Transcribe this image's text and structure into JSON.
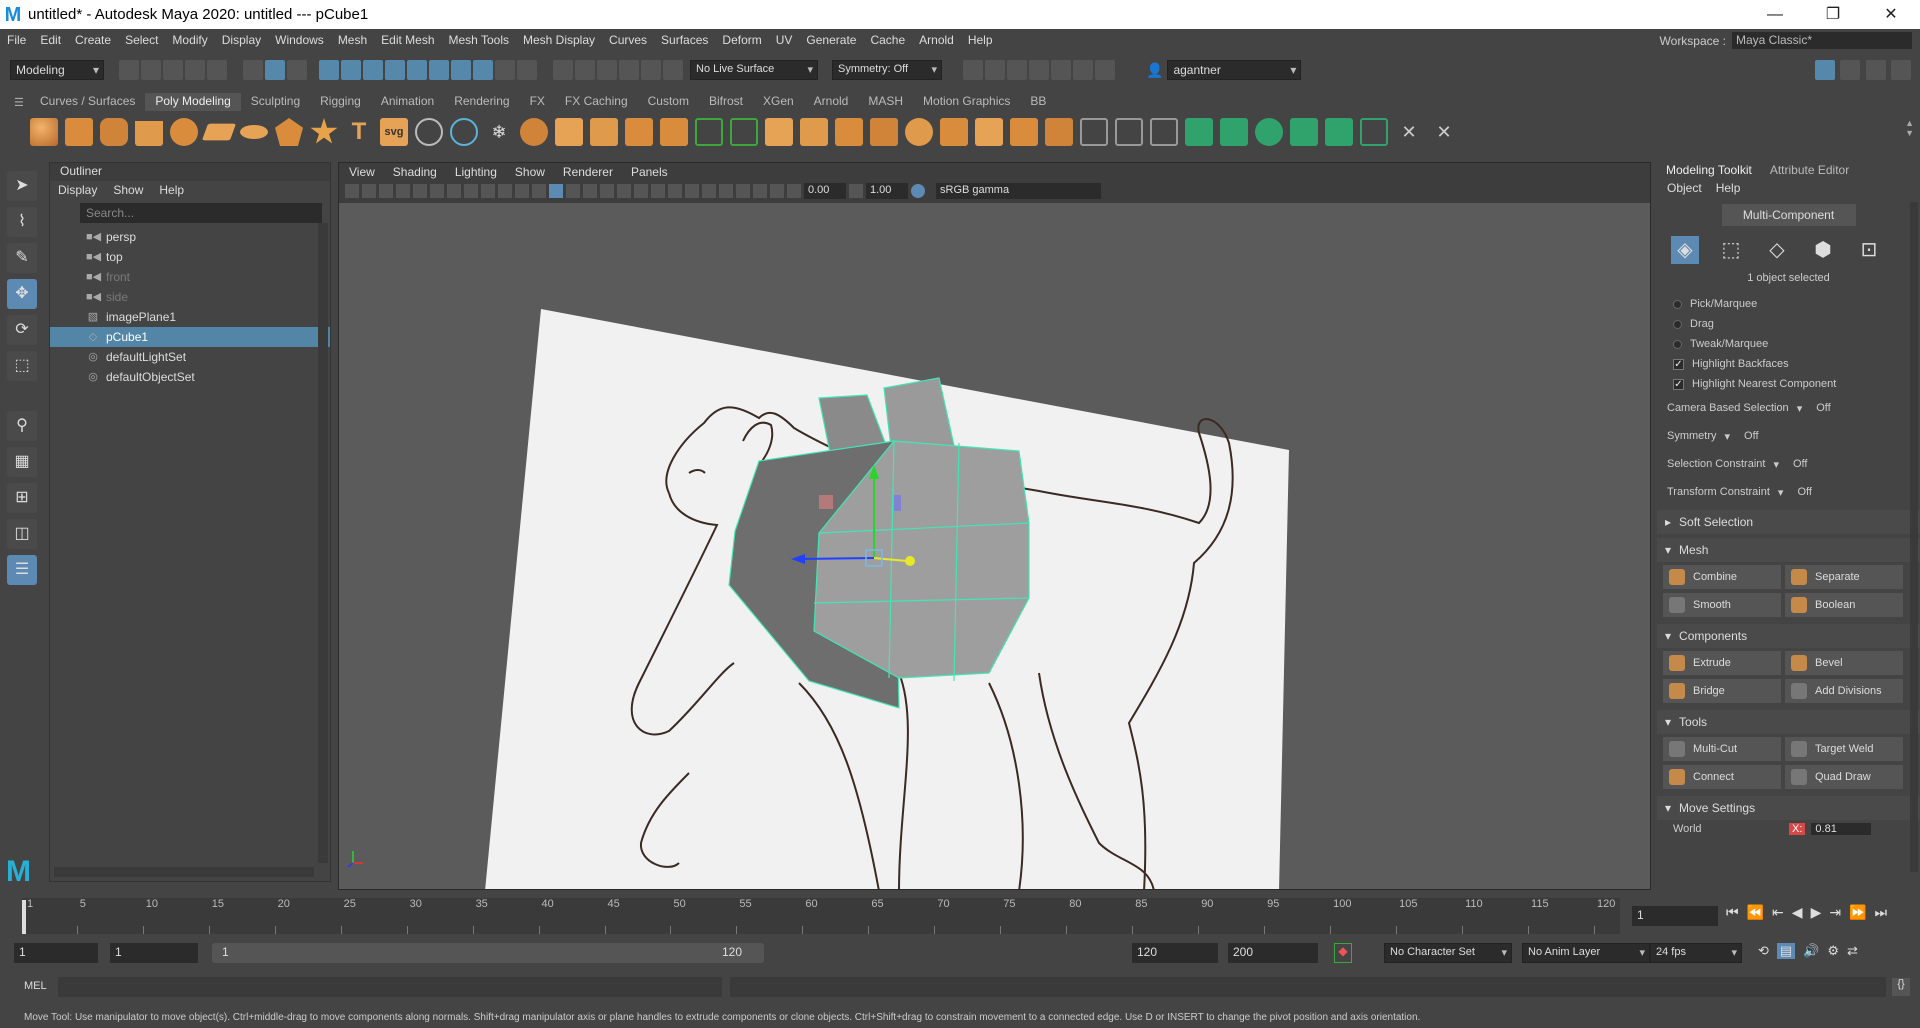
{
  "window": {
    "title": "untitled* - Autodesk Maya 2020: untitled   ---   pCube1",
    "app_icon_letter": "M",
    "controls": [
      "—",
      "❐",
      "✕"
    ]
  },
  "menubar": [
    "File",
    "Edit",
    "Create",
    "Select",
    "Modify",
    "Display",
    "Windows",
    "Mesh",
    "Edit Mesh",
    "Mesh Tools",
    "Mesh Display",
    "Curves",
    "Surfaces",
    "Deform",
    "UV",
    "Generate",
    "Cache",
    "Arnold",
    "Help"
  ],
  "workspace": {
    "label": "Workspace :",
    "value": "Maya Classic*"
  },
  "statusline": {
    "mode": "Modeling",
    "live_surface": "No Live Surface",
    "symmetry": "Symmetry: Off",
    "user": "agantner"
  },
  "shelf_tabs": [
    "Curves / Surfaces",
    "Poly Modeling",
    "Sculpting",
    "Rigging",
    "Animation",
    "Rendering",
    "FX",
    "FX Caching",
    "Custom",
    "Bifrost",
    "XGen",
    "Arnold",
    "MASH",
    "Motion Graphics",
    "BB"
  ],
  "shelf_active": "Poly Modeling",
  "outliner": {
    "title": "Outliner",
    "menu": [
      "Display",
      "Show",
      "Help"
    ],
    "search_placeholder": "Search...",
    "items": [
      {
        "label": "persp",
        "icon": "camera-icon",
        "dim": false
      },
      {
        "label": "top",
        "icon": "camera-icon",
        "dim": false
      },
      {
        "label": "front",
        "icon": "camera-icon",
        "dim": true
      },
      {
        "label": "side",
        "icon": "camera-icon",
        "dim": true
      },
      {
        "label": "imagePlane1",
        "icon": "image-plane-icon",
        "dim": false
      },
      {
        "label": "pCube1",
        "icon": "mesh-icon",
        "dim": false,
        "selected": true
      },
      {
        "label": "defaultLightSet",
        "icon": "set-icon",
        "dim": false
      },
      {
        "label": "defaultObjectSet",
        "icon": "set-icon",
        "dim": false
      }
    ]
  },
  "viewport": {
    "menu": [
      "View",
      "Shading",
      "Lighting",
      "Show",
      "Renderer",
      "Panels"
    ],
    "exposure": "0.00",
    "gamma": "1.00",
    "color_space": "sRGB gamma"
  },
  "toolkit": {
    "tabs": [
      "Modeling Toolkit",
      "Attribute Editor"
    ],
    "menu": [
      "Object",
      "Help"
    ],
    "multi_component": "Multi-Component",
    "selection_info": "1 object selected",
    "radios": [
      "Pick/Marquee",
      "Drag",
      "Tweak/Marquee"
    ],
    "checks": [
      "Highlight Backfaces",
      "Highlight Nearest Component"
    ],
    "options": [
      {
        "label": "Camera Based Selection",
        "value": "Off"
      },
      {
        "label": "Symmetry",
        "value": "Off"
      },
      {
        "label": "Selection Constraint",
        "value": "Off"
      },
      {
        "label": "Transform Constraint",
        "value": "Off"
      }
    ],
    "soft_selection": "Soft Selection",
    "sections": {
      "mesh": {
        "title": "Mesh",
        "buttons": [
          "Combine",
          "Separate",
          "Smooth",
          "Boolean"
        ]
      },
      "components": {
        "title": "Components",
        "buttons": [
          "Extrude",
          "Bevel",
          "Bridge",
          "Add Divisions"
        ]
      },
      "tools": {
        "title": "Tools",
        "buttons": [
          "Multi-Cut",
          "Target Weld",
          "Connect",
          "Quad Draw"
        ]
      }
    },
    "move_settings": "Move Settings",
    "world": "World",
    "x_label": "X:",
    "x_value": "0.81"
  },
  "timeline": {
    "ticks": [
      "1",
      "5",
      "10",
      "15",
      "20",
      "25",
      "30",
      "35",
      "40",
      "45",
      "50",
      "55",
      "60",
      "65",
      "70",
      "75",
      "80",
      "85",
      "90",
      "95",
      "100",
      "105",
      "110",
      "115",
      "120"
    ],
    "current_frame": "1"
  },
  "range": {
    "start": "1",
    "anim_start": "1",
    "slider_start": "1",
    "slider_end": "120",
    "anim_end_field": "120",
    "end": "200",
    "character_set": "No Character Set",
    "anim_layer": "No Anim Layer",
    "fps": "24 fps"
  },
  "mel": {
    "label": "MEL"
  },
  "helpline": "Move Tool: Use manipulator to move object(s). Ctrl+middle-drag to move components along normals. Shift+drag manipulator axis or plane handles to extrude components or clone objects. Ctrl+Shift+drag to constrain movement to a connected edge. Use D or INSERT to change the pivot position and axis orientation."
}
